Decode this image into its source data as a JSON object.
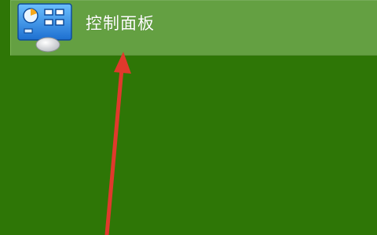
{
  "start_menu": {
    "item": {
      "label": "控制面板",
      "icon": "control-panel-icon"
    }
  },
  "annotation": {
    "type": "arrow",
    "color": "#e0392c"
  },
  "colors": {
    "desktop_bg": "#2e7606",
    "item_highlight": "#64a042",
    "label_text": "#ffffff"
  }
}
